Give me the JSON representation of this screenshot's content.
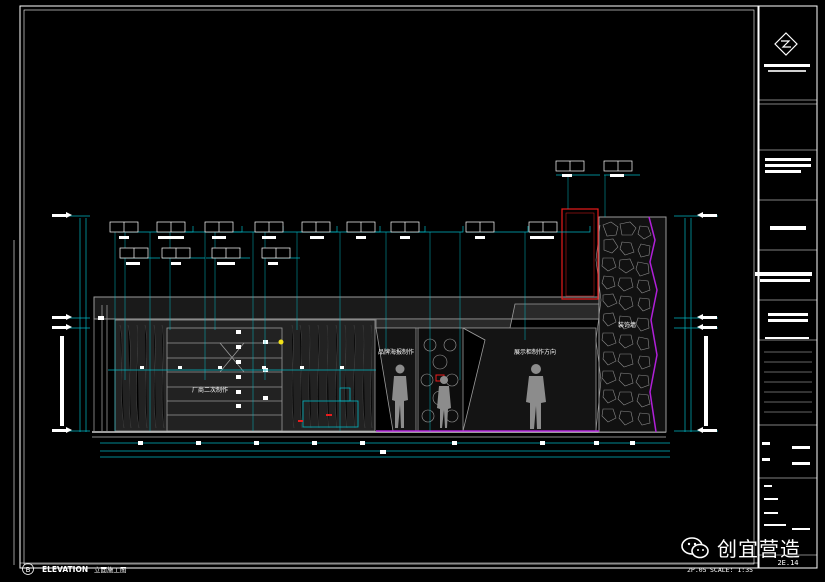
{
  "title_block": {
    "drawing_no": "2E.14"
  },
  "footer": {
    "marker": "B",
    "view_name": "ELEVATION",
    "view_cn": "立面施工图",
    "sheet_ref": "2P.05",
    "scale": "SCALE: 1:35"
  },
  "annotations": {
    "zone_a": "厂商二次制作",
    "zone_b": "品牌海报制作",
    "zone_c": "展示柜制作方向",
    "zone_d": "装饰墙"
  },
  "watermark": {
    "text": "创宜营造"
  },
  "colors": {
    "background": "#000000",
    "border": "#ffffff",
    "dimension": "#00b7c3",
    "wall": "#7f7f7f",
    "accent_red": "#e81c1c",
    "accent_magenta": "#b020d8",
    "accent_yellow": "#f2e21a"
  }
}
